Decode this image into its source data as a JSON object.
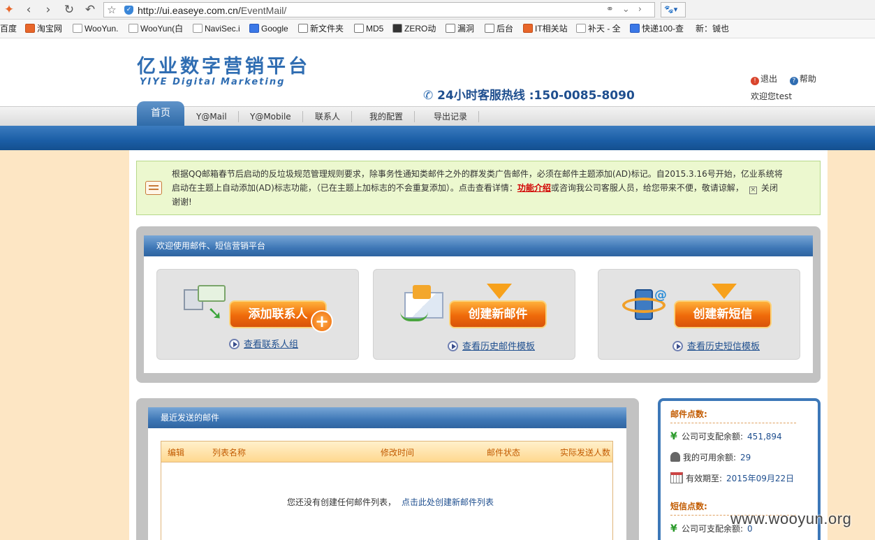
{
  "browser": {
    "url_host": "http://ui.easeye.com.cn/",
    "url_path": "EventMail/",
    "bookmarks": [
      "百度",
      "淘宝网",
      "WooYun.",
      "WooYun(白",
      "NaviSec.i",
      "Google",
      "新文件夹",
      "MD5",
      "ZERO动",
      "漏洞",
      "后台",
      "IT相关站",
      "补天 - 全",
      "快递100-查",
      "新：铖也"
    ]
  },
  "header": {
    "logo_cn": "亿业数字营销平台",
    "logo_en": "YIYE Digital Marketing",
    "hotline": "24小时客服热线 :150-0085-8090",
    "logout": "退出",
    "help": "帮助",
    "welcome": "欢迎您test"
  },
  "menu": {
    "home": "首页",
    "items": [
      "Y@Mail",
      "Y@Mobile",
      "联系人",
      "我的配置",
      "导出记录"
    ]
  },
  "notice": {
    "text1": "根据QQ邮箱春节后启动的反垃圾规范管理规则要求，除事务性通知类邮件之外的群发类广告邮件，必须在邮件主题添加(AD)标记。自2015.3.16号开始，亿业系统将启动在主题上自动添加(AD)标志功能，（已在主题上加标志的不会重复添加）。点击查看详情：",
    "link": "功能介绍",
    "text2": "或咨询我公司客服人员，给您带来不便，敬请谅解，",
    "close": "关闭",
    "thanks": "谢谢!"
  },
  "welcome_panel": {
    "title": "欢迎使用邮件、短信营销平台",
    "cards": [
      {
        "button": "添加联系人",
        "link": "查看联系人组"
      },
      {
        "button": "创建新邮件",
        "link": "查看历史邮件模板"
      },
      {
        "button": "创建新短信",
        "link": "查看历史短信模板"
      }
    ]
  },
  "recent_mail": {
    "title": "最近发送的邮件",
    "columns": [
      "编辑",
      "列表名称",
      "修改时间",
      "邮件状态",
      "实际发送人数"
    ],
    "empty_text": "您还没有创建任何邮件列表，",
    "empty_link": "点击此处创建新邮件列表"
  },
  "points": {
    "mail_title": "邮件点数:",
    "mail_company_label": "公司可支配余额:",
    "mail_company_value": "451,894",
    "mail_my_label": "我的可用余额:",
    "mail_my_value": "29",
    "mail_expire_label": "有效期至:",
    "mail_expire_value": "2015年09月22日",
    "sms_title": "短信点数:",
    "sms_company_label": "公司可支配余额:",
    "sms_company_value": "0"
  },
  "watermark": "www.wooyun.org",
  "colors": {
    "brand_blue": "#2f6db2",
    "accent_orange": "#ef6a0a",
    "page_bg": "#fde6c4"
  }
}
